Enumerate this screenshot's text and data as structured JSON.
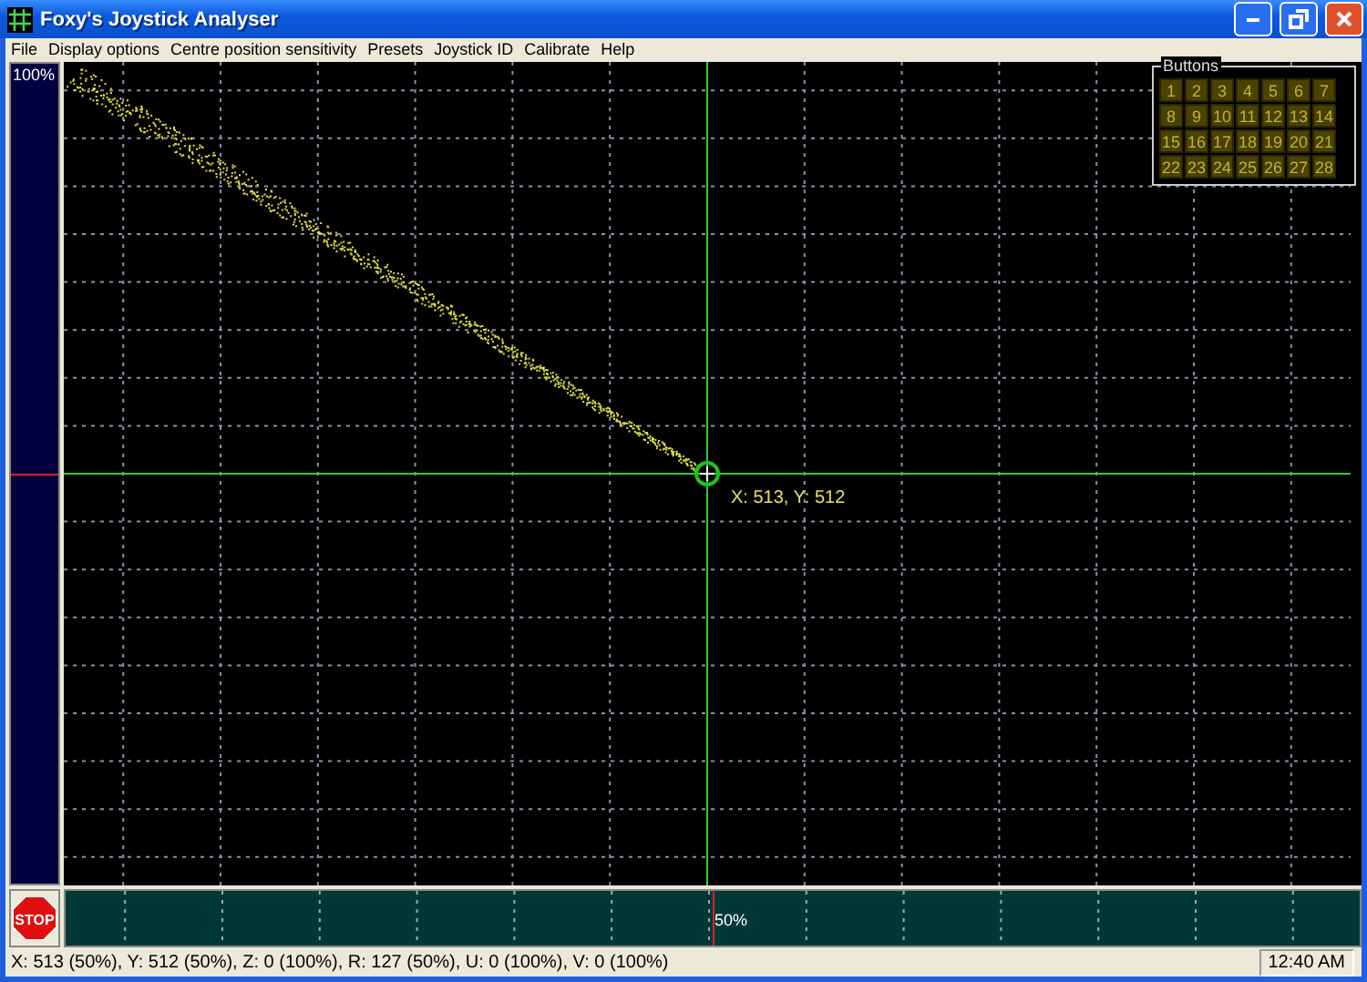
{
  "window": {
    "title": "Foxy's Joystick Analyser"
  },
  "menu": [
    "File",
    "Display options",
    "Centre position sensitivity",
    "Presets",
    "Joystick ID",
    "Calibrate",
    "Help"
  ],
  "vertical_gauge": {
    "label": "100%",
    "level": 0.5
  },
  "plot": {
    "cursor_label": "X: 513, Y: 512"
  },
  "buttons_panel": {
    "title": "Buttons",
    "buttons": [
      "1",
      "2",
      "3",
      "4",
      "5",
      "6",
      "7",
      "8",
      "9",
      "10",
      "11",
      "12",
      "13",
      "14",
      "15",
      "16",
      "17",
      "18",
      "19",
      "20",
      "21",
      "22",
      "23",
      "24",
      "25",
      "26",
      "27",
      "28"
    ]
  },
  "stop_button": {
    "label": "STOP"
  },
  "horizontal_gauge": {
    "label": "50%",
    "level": 0.5
  },
  "status_bar": {
    "readout": "X: 513 (50%), Y: 512 (50%), Z: 0 (100%), R: 127 (50%), U: 0 (100%), V: 0 (100%)",
    "time": "12:40 AM"
  }
}
